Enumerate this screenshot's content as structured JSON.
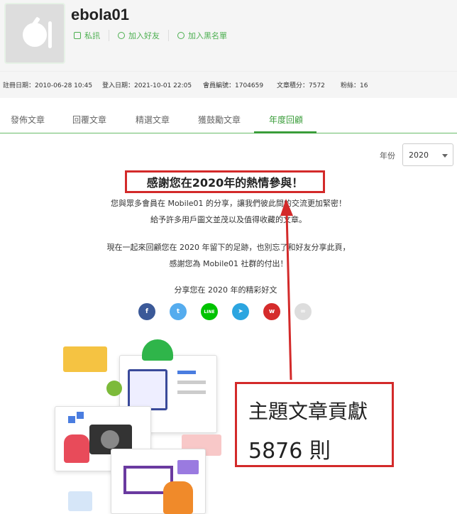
{
  "profile": {
    "username": "ebola01",
    "actions": [
      {
        "label": "私訊",
        "icon": "mail-icon"
      },
      {
        "label": "加入好友",
        "icon": "add-friend-icon"
      },
      {
        "label": "加入黑名單",
        "icon": "block-icon"
      }
    ]
  },
  "stats": {
    "registered": "註冊日期：2010-06-28 10:45",
    "last_login": "登入日期：2021-10-01 22:05",
    "member_id": "會員編號：1704659",
    "points": "文章積分：7572",
    "fans": "粉絲：16"
  },
  "tabs": [
    "發佈文章",
    "回覆文章",
    "精選文章",
    "獲鼓勵文章",
    "年度回顧"
  ],
  "active_tab": "年度回顧",
  "year": {
    "label": "年份",
    "selected": "2020"
  },
  "review": {
    "headline": "感謝您在2020年的熱情參與！",
    "line1": "您與眾多會員在 Mobile01 的分享，讓我們彼此間的交流更加緊密！",
    "line2": "給予許多用戶圖文並茂以及值得收藏的文章。",
    "line3": "現在一起來回顧您在 2020 年留下的足跡，也別忘了和好友分享此頁，",
    "line4": "感謝您為 Mobile01 社群的付出！",
    "share_title": "分享您在 2020 年的精彩好文"
  },
  "share_buttons": [
    {
      "name": "facebook-icon",
      "glyph": "f",
      "color": "#3b5998"
    },
    {
      "name": "twitter-icon",
      "glyph": "t",
      "color": "#55acee"
    },
    {
      "name": "line-icon",
      "glyph": "LINE",
      "color": "#00c300"
    },
    {
      "name": "telegram-icon",
      "glyph": "➤",
      "color": "#2ca5e0"
    },
    {
      "name": "weibo-icon",
      "glyph": "w",
      "color": "#d52b2b"
    },
    {
      "name": "link-icon",
      "glyph": "∞",
      "color": "#dddddd"
    }
  ],
  "callout": {
    "line1": "主題文章貢獻",
    "line2": "5876 則"
  },
  "colors": {
    "accent": "#3a9d3a",
    "annotation": "#d32a2a"
  }
}
